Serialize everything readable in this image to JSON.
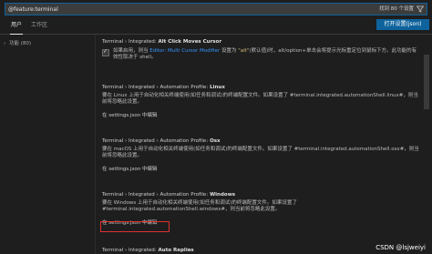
{
  "search": {
    "value": "@feature:terminal",
    "result_count": "找到 80 个设置"
  },
  "icons": {
    "filter": "filter-icon",
    "chevron": "chevron-right-icon",
    "checkmark": "check-icon"
  },
  "tabs": [
    {
      "label": "用户"
    },
    {
      "label": "工作区"
    }
  ],
  "open_json_label": "打开设置(json)",
  "tree": {
    "item_label": "功能 (80)"
  },
  "settings": [
    {
      "category": "Terminal › Integrated:",
      "name": "Alt Click Moves Cursor",
      "desc_before_link": "如果启用，则当 ",
      "link": "Editor: Multi Cursor Modifier",
      "desc_mid": " 设置为 ",
      "code": "\"alt\"",
      "desc_after": "(默认值)时，alt/option+单击会将提示光标重定位到鼠标下方。此功能的有效性取决于 shell。"
    },
    {
      "category": "Terminal › Integrated › Automation Profile:",
      "name": "Linux",
      "desc": "要在 Linux 上用于自动化相关终端使用(如任务和调试)的终端配置文件。如果设置了 #terminal.integrated.automationShell.linux#，则当前将忽略此设置。",
      "edit_label": "在 settings.json 中编辑"
    },
    {
      "category": "Terminal › Integrated › Automation Profile:",
      "name": "Osx",
      "desc": "要在 macOS 上用于自动化相关终端使用(如任务和调试)的终端配置文件。如果设置了 #terminal.integrated.automationShell.osx#，则当前将忽略此设置。",
      "edit_label": "在 settings.json 中编辑"
    },
    {
      "category": "Terminal › Integrated › Automation Profile:",
      "name": "Windows",
      "desc": "要在 Windows 上用于自动化相关终端使用(如任务和调试)的终端配置文件。如果设置了 #terminal.integrated.automationShell.windows#，则当前将忽略此设置。",
      "edit_label": "在 settings.json 中编辑"
    },
    {
      "category": "Terminal › Integrated:",
      "name": "Auto Replies"
    }
  ],
  "watermark": "CSDN @lsjweiyi",
  "colors": {
    "accent": "#0e639c",
    "link": "#3794ff",
    "highlight": "#e03030",
    "background": "#1e1e1e"
  }
}
